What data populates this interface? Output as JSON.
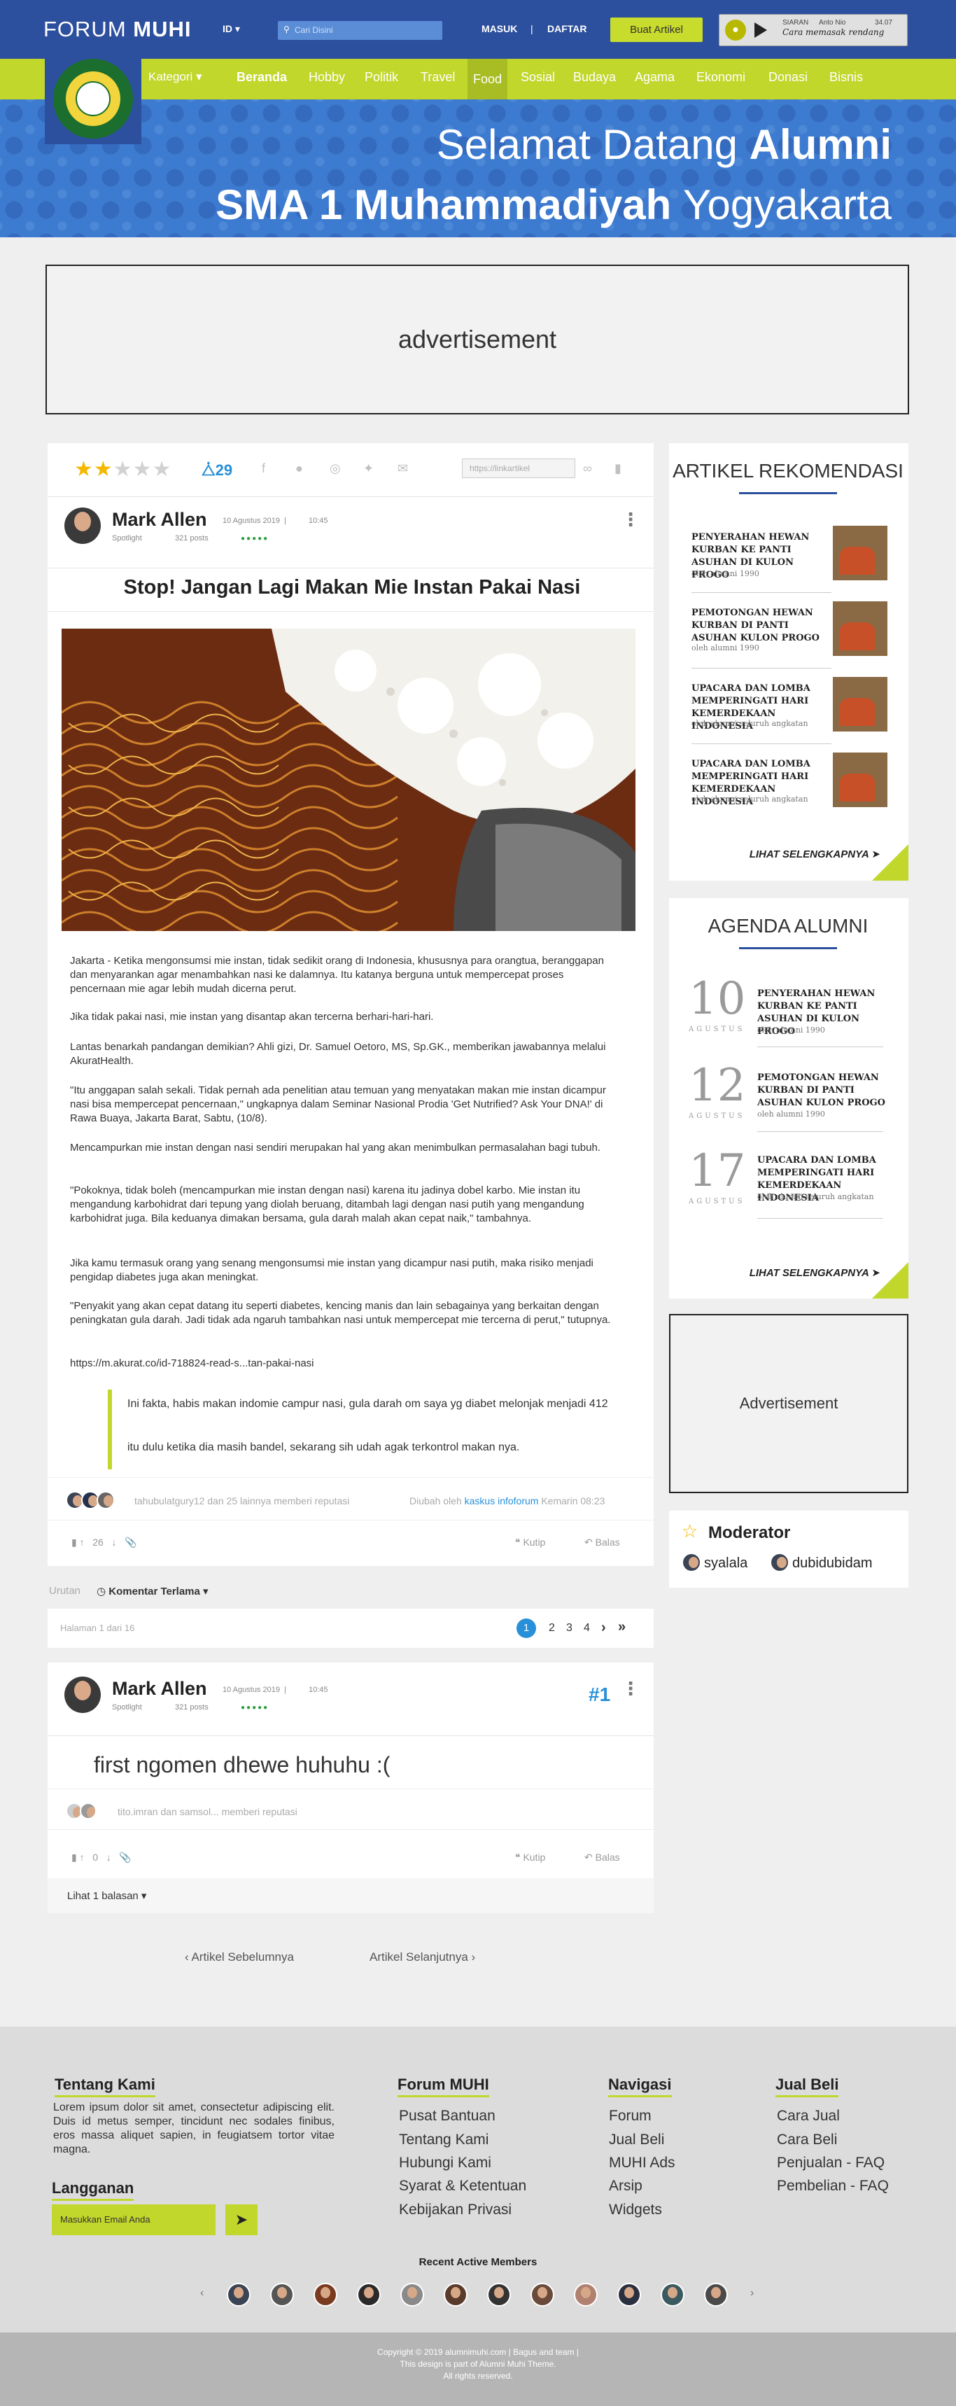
{
  "header": {
    "logo_light": "FORUM",
    "logo_bold": "MUHI",
    "lang": "ID ▾",
    "search_placeholder": "Cari Disini",
    "masuk": "MASUK",
    "divider": "|",
    "daftar": "DAFTAR",
    "buat": "Buat Artikel",
    "radio": {
      "label": "SIARAN",
      "host": "Anto Nio",
      "time": "34.07",
      "show": "Cara memasak rendang"
    }
  },
  "nav": {
    "kategori": "Kategori ▾",
    "items": [
      "Beranda",
      "Hobby",
      "Politik",
      "Travel",
      "Food",
      "Sosial",
      "Budaya",
      "Agama",
      "Ekonomi",
      "Donasi",
      "Bisnis"
    ]
  },
  "hero": {
    "line1_light": "Selamat Datang ",
    "line1_bold": "Alumni",
    "line2_bold": "SMA 1 Muhammadiyah ",
    "line2_light": "Yogyakarta"
  },
  "ad_top": "advertisement",
  "article": {
    "share_count": "29",
    "link_placeholder": "https://linkartikel",
    "author": "Mark Allen",
    "date": "10 Agustus 2019",
    "time": "10:45",
    "role": "Spotlight",
    "posts": "321 posts",
    "title": "Stop! Jangan Lagi Makan Mie Instan Pakai Nasi",
    "paragraphs": [
      "Jakarta - Ketika mengonsumsi mie instan, tidak sedikit orang di Indonesia, khususnya para orangtua, beranggapan dan menyarankan agar menambahkan nasi ke dalamnya. Itu katanya berguna untuk mempercepat proses pencernaan mie agar lebih mudah dicerna perut.",
      "Jika tidak pakai nasi, mie instan yang disantap akan tercerna berhari-hari-hari.",
      "Lantas benarkah pandangan demikian? Ahli gizi, Dr. Samuel Oetoro, MS, Sp.GK., memberikan jawabannya melalui AkuratHealth.",
      "\"Itu anggapan salah sekali. Tidak pernah ada penelitian atau temuan yang menyatakan makan mie instan dicampur nasi bisa mempercepat pencernaan,\" ungkapnya dalam Seminar Nasional Prodia 'Get Nutrified? Ask Your DNA!' di Rawa Buaya, Jakarta Barat, Sabtu, (10/8).",
      "Mencampurkan mie instan dengan nasi sendiri merupakan hal yang akan menimbulkan permasalahan bagi tubuh.",
      "\"Pokoknya, tidak boleh (mencampurkan mie instan dengan nasi) karena itu jadinya dobel karbo. Mie instan itu mengandung karbohidrat dari tepung yang diolah beruang, ditambah lagi dengan nasi putih yang mengandung karbohidrat juga. Bila keduanya dimakan bersama, gula darah malah akan cepat naik,\" tambahnya.",
      "Jika kamu termasuk orang yang senang mengonsumsi mie instan yang dicampur nasi putih, maka risiko menjadi pengidap diabetes juga akan meningkat.",
      "\"Penyakit yang akan cepat datang itu seperti diabetes, kencing manis dan lain sebagainya yang berkaitan dengan peningkatan gula darah. Jadi tidak ada ngaruh tambahkan nasi untuk mempercepat mie tercerna di perut,\" tutupnya.",
      "https://m.akurat.co/id-718824-read-s...tan-pakai-nasi"
    ],
    "quote1": "Ini fakta, habis makan indomie campur nasi, gula darah om saya yg diabet melonjak menjadi 412",
    "quote2": "itu dulu ketika dia masih bandel, sekarang sih udah agak terkontrol makan nya.",
    "reputation": "tahubulatgury12 dan 25 lainnya memberi reputasi",
    "edited_prefix": "Diubah oleh ",
    "edited_by": "kaskus infoforum",
    "edited_suffix": " Kemarin 08:23",
    "votes": "26",
    "kutip": "Kutip",
    "balas": "Balas"
  },
  "sort": {
    "label": "Urutan",
    "value": "Komentar Terlama ▾"
  },
  "pagination": {
    "info": "Halaman 1 dari 16",
    "pages": [
      "1",
      "2",
      "3",
      "4"
    ],
    "next": "›",
    "last": "»"
  },
  "comment": {
    "author": "Mark Allen",
    "date": "10 Agustus 2019",
    "time": "10:45",
    "role": "Spotlight",
    "posts": "321 posts",
    "num": "#1",
    "text": "first ngomen dhewe huhuhu :(",
    "reputation": "tito.imran dan samsol... memberi reputasi",
    "votes": "0",
    "kutip": "Kutip",
    "balas": "Balas",
    "replies": "Lihat 1 balasan ▾"
  },
  "prevnext": {
    "prev": "‹  Artikel Sebelumnya",
    "next": "Artikel Selanjutnya  ›"
  },
  "sidebar": {
    "rec_title": "ARTIKEL REKOMENDASI",
    "rec": [
      {
        "title": "PENYERAHAN HEWAN KURBAN KE PANTI ASUHAN DI KULON PROGO",
        "by": "oleh alumni 1990"
      },
      {
        "title": "PEMOTONGAN HEWAN KURBAN DI PANTI ASUHAN KULON PROGO",
        "by": "oleh alumni 1990"
      },
      {
        "title": "UPACARA DAN LOMBA MEMPERINGATI HARI KEMERDEKAAN INDONESIA",
        "by": "oleh alumni seluruh angkatan"
      },
      {
        "title": "UPACARA DAN LOMBA MEMPERINGATI HARI KEMERDEKAAN INDONESIA",
        "by": "oleh alumni seluruh angkatan"
      }
    ],
    "more": "LIHAT SELENGKAPNYA",
    "agenda_title": "AGENDA ALUMNI",
    "agenda": [
      {
        "day": "10",
        "month": "AGUSTUS",
        "title": "PENYERAHAN HEWAN KURBAN KE PANTI ASUHAN DI KULON PROGO",
        "by": "oleh alumni 1990"
      },
      {
        "day": "12",
        "month": "AGUSTUS",
        "title": "PEMOTONGAN HEWAN KURBAN DI PANTI ASUHAN KULON PROGO",
        "by": "oleh alumni 1990"
      },
      {
        "day": "17",
        "month": "AGUSTUS",
        "title": "UPACARA DAN LOMBA MEMPERINGATI HARI KEMERDEKAAN INDONESIA",
        "by": "oleh alumni seluruh angkatan"
      }
    ],
    "ad": "Advertisement",
    "mod_title": "Moderator",
    "mods": [
      "syalala",
      "dubidubidam"
    ]
  },
  "footer": {
    "about_title": "Tentang Kami",
    "about_text": "Lorem ipsum dolor sit amet, consectetur adipiscing elit. Duis id metus semper, tincidunt nec sodales finibus, eros massa aliquet sapien, in feugiatsem tortor vitae magna.",
    "sub_title": "Langganan",
    "sub_placeholder": "Masukkan Email Anda",
    "forum_title": "Forum MUHI",
    "forum": [
      "Pusat Bantuan",
      "Tentang Kami",
      "Hubungi Kami",
      "Syarat & Ketentuan",
      "Kebijakan Privasi"
    ],
    "nav_title": "Navigasi",
    "navlinks": [
      "Forum",
      "Jual Beli",
      "MUHI Ads",
      "Arsip",
      "Widgets"
    ],
    "jb_title": "Jual Beli",
    "jb": [
      "Cara Jual",
      "Cara Beli",
      "Penjualan - FAQ",
      "Pembelian - FAQ"
    ],
    "members_title": "Recent Active Members",
    "copy1": "Copyright © 2019 alumnimuhi.com | Bagus and team |",
    "copy2": "This design is part of Alumni Muhi Theme.",
    "copy3": "All rights reserved."
  },
  "colors": {
    "primary": "#2c4f9e",
    "accent": "#c1d72c",
    "link": "#2890d8"
  }
}
